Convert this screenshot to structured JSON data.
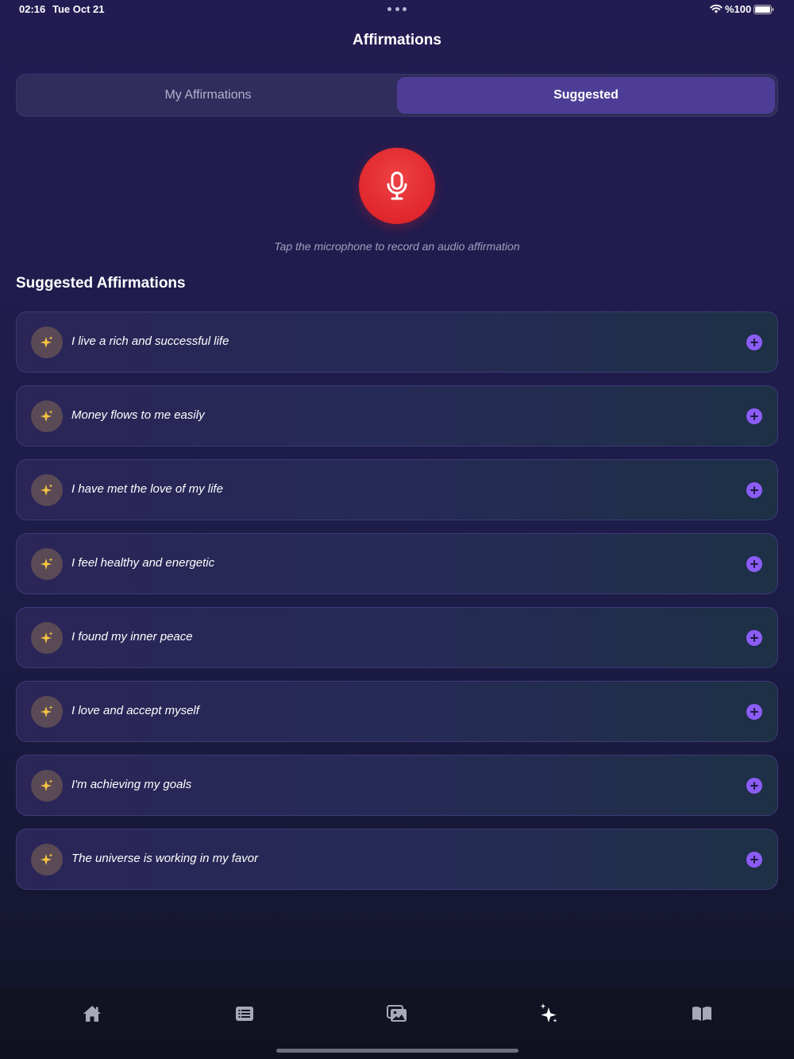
{
  "status_bar": {
    "time": "02:16",
    "date": "Tue Oct 21",
    "battery_text": "%100"
  },
  "header": {
    "title": "Affirmations"
  },
  "tabs": [
    {
      "label": "My Affirmations",
      "selected": false
    },
    {
      "label": "Suggested",
      "selected": true
    }
  ],
  "recorder": {
    "hint": "Tap the microphone to record an audio affirmation",
    "icon": "microphone-icon"
  },
  "suggested": {
    "title": "Suggested Affirmations",
    "items": [
      {
        "text": "I live a rich and successful life"
      },
      {
        "text": "Money flows to me easily"
      },
      {
        "text": "I have met the love of my life"
      },
      {
        "text": "I feel healthy and energetic"
      },
      {
        "text": "I found my inner peace"
      },
      {
        "text": "I love and accept myself"
      },
      {
        "text": "I'm achieving my goals"
      },
      {
        "text": "The universe is working in my favor"
      }
    ]
  },
  "tab_bar": {
    "items": [
      "home-icon",
      "list-icon",
      "gallery-icon",
      "sparkles-icon",
      "book-icon"
    ],
    "selected_index": 3
  },
  "colors": {
    "accent": "#8b5cf6",
    "mic": "#e0272c",
    "selected_tab": "#4e3d96",
    "sparkle": "#f5c242"
  }
}
